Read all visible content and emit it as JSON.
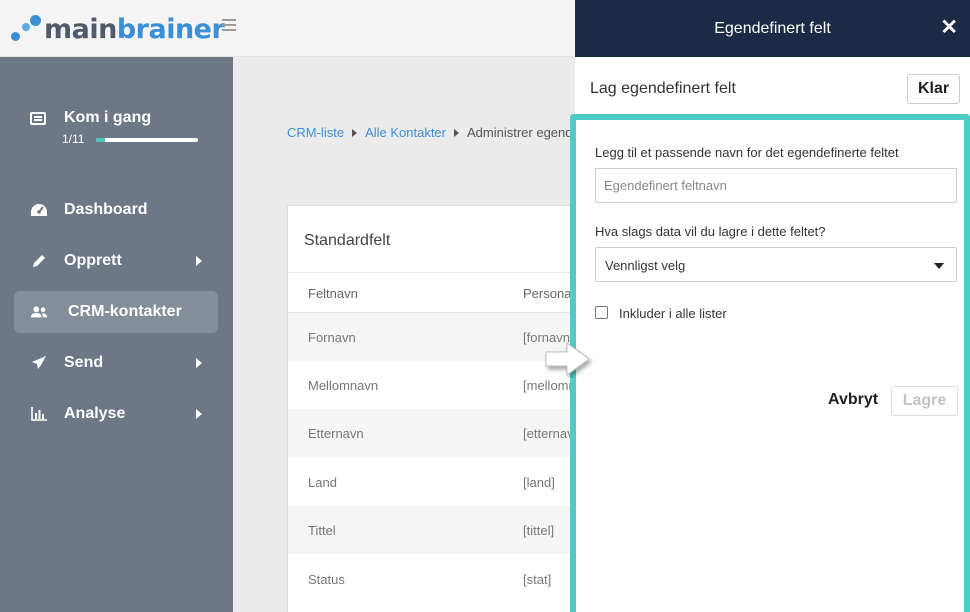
{
  "brand": {
    "name_part1": "main",
    "name_part2": "brainer",
    "logo_colors": [
      "#3b8fd6",
      "#5aa9e8",
      "#4f5b6b"
    ]
  },
  "sidebar": {
    "getting_started": {
      "title": "Kom i gang",
      "progress_text": "1/11",
      "progress": 0.09
    },
    "items": [
      {
        "label": "Dashboard",
        "icon": "dashboard-icon",
        "has_submenu": false,
        "active": false
      },
      {
        "label": "Opprett",
        "icon": "pencil-icon",
        "has_submenu": true,
        "active": false
      },
      {
        "label": "CRM-kontakter",
        "icon": "users-icon",
        "has_submenu": false,
        "active": true
      },
      {
        "label": "Send",
        "icon": "paper-plane-icon",
        "has_submenu": true,
        "active": false
      },
      {
        "label": "Analyse",
        "icon": "bar-chart-icon",
        "has_submenu": true,
        "active": false
      }
    ]
  },
  "breadcrumb": {
    "crumbs": [
      "CRM-liste",
      "Alle Kontakter"
    ],
    "current": "Administrer egendefinerte felt"
  },
  "standard_fields": {
    "title": "Standardfelt",
    "columns": [
      "Feltnavn",
      "Personaliseringskode"
    ],
    "rows": [
      [
        "Fornavn",
        "[fornavn]"
      ],
      [
        "Mellomnavn",
        "[mellomnavn]"
      ],
      [
        "Etternavn",
        "[etternavn]"
      ],
      [
        "Land",
        "[land]"
      ],
      [
        "Tittel",
        "[tittel]"
      ],
      [
        "Status",
        "[stat]"
      ]
    ]
  },
  "panel": {
    "header_title": "Egendefinert felt",
    "subtitle": "Lag egendefinert felt",
    "done_label": "Klar",
    "name_label": "Legg til et passende navn for det egendefinerte feltet",
    "name_placeholder": "Egendefinert feltnavn",
    "type_label": "Hva slags data vil du lagre i dette feltet?",
    "type_value": "Vennligst velg",
    "include_label": "Inkluder i alle lister",
    "include_checked": false,
    "cancel_label": "Avbryt",
    "save_label": "Lagre",
    "highlight_color": "#4ecdc4",
    "header_color": "#1b2b45"
  }
}
